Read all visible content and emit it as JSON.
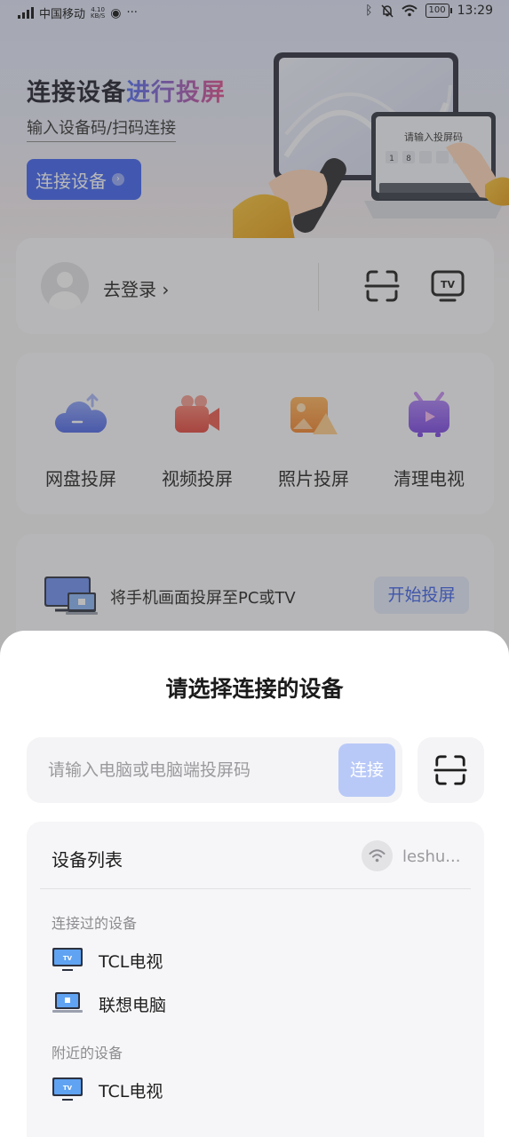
{
  "status_bar": {
    "carrier": "中国移动",
    "net_speed_value": "4.10",
    "net_speed_unit": "KB/S",
    "more": "···",
    "battery": "100",
    "time": "13:29"
  },
  "hero": {
    "title_plain": "连接设备",
    "title_highlight": "进行投屏",
    "subtitle": "输入设备码/扫码连接",
    "button_label": "连接设备",
    "illustration_caption": "请输入投屏码",
    "illustration_keys": [
      "1",
      "8"
    ],
    "accent_color": "#3f63f0"
  },
  "login_card": {
    "login_label": "去登录 ›",
    "actions": [
      "scan-icon",
      "tv-icon"
    ]
  },
  "functions": [
    {
      "label": "网盘投屏",
      "icon": "cloud-upload-icon"
    },
    {
      "label": "视频投屏",
      "icon": "video-camera-icon"
    },
    {
      "label": "照片投屏",
      "icon": "photo-icon"
    },
    {
      "label": "清理电视",
      "icon": "tv-clean-icon"
    }
  ],
  "cast_card": {
    "text": "将手机画面投屏至PC或TV",
    "button_label": "开始投屏"
  },
  "sheet": {
    "title": "请选择连接的设备",
    "input_placeholder": "请输入电脑或电脑端投屏码",
    "input_value": "",
    "connect_label": "连接",
    "list": {
      "title": "设备列表",
      "wifi_name": "leshu...",
      "connected_section": "连接过的设备",
      "connected_devices": [
        {
          "name": "TCL电视",
          "type": "tv"
        },
        {
          "name": "联想电脑",
          "type": "laptop"
        }
      ],
      "nearby_section": "附近的设备",
      "nearby_devices": [
        {
          "name": "TCL电视",
          "type": "tv"
        }
      ]
    }
  }
}
